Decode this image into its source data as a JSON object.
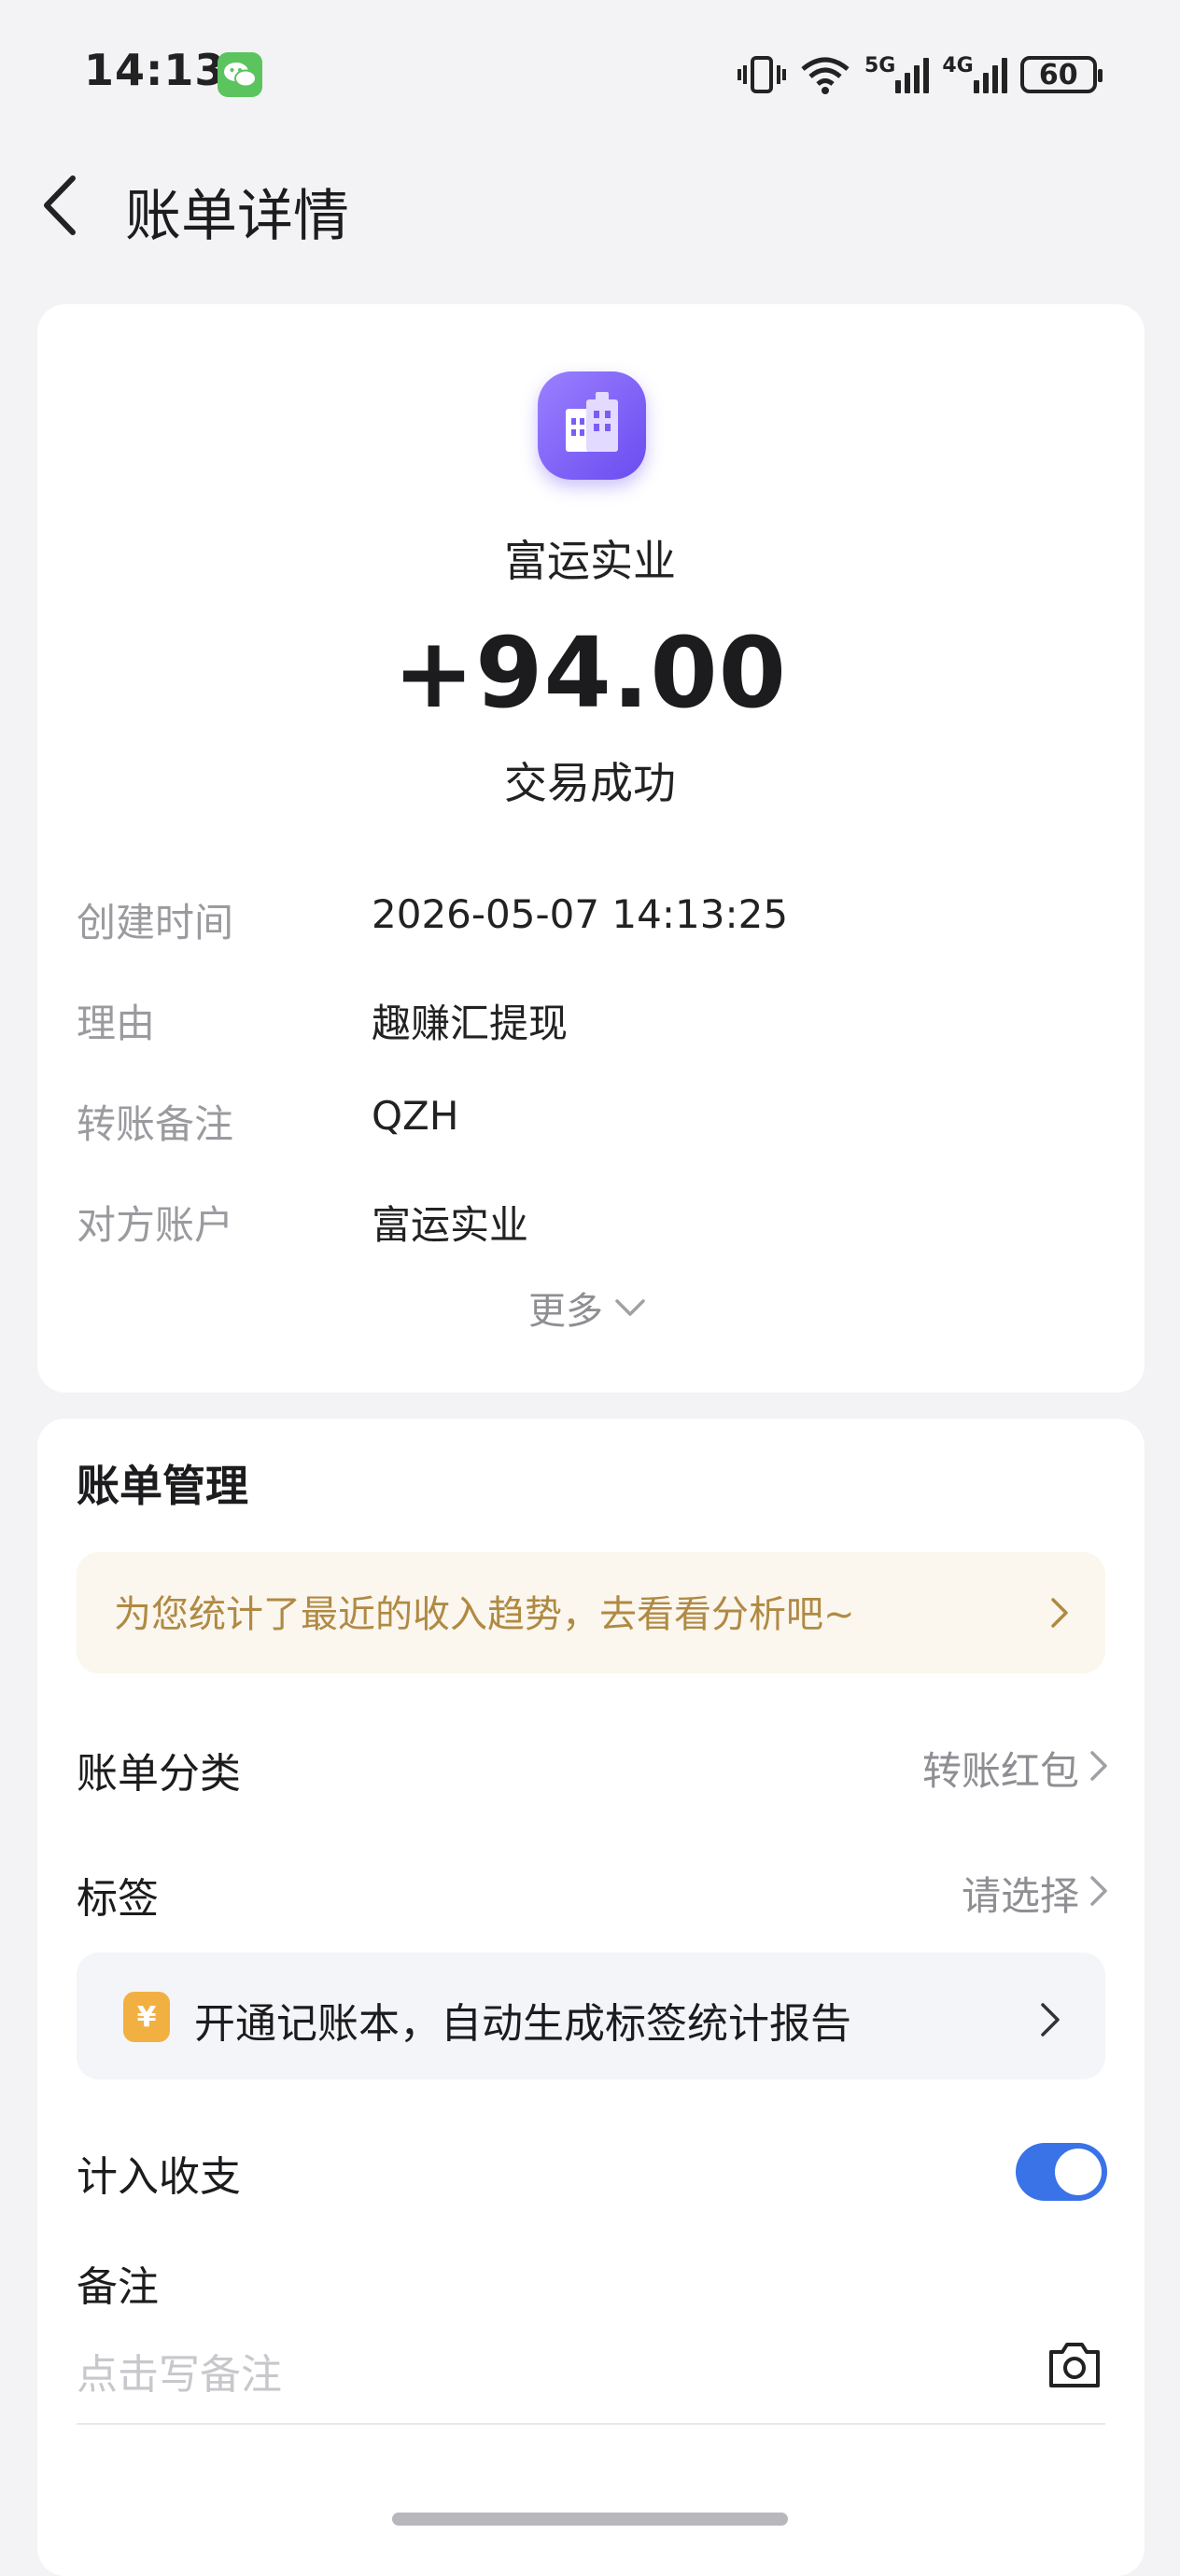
{
  "status_bar": {
    "time": "14:13",
    "network_5g": "5G",
    "network_4g": "4G",
    "battery": "60"
  },
  "header": {
    "title": "账单详情"
  },
  "transaction": {
    "merchant": "富运实业",
    "amount": "+94.00",
    "status": "交易成功",
    "details": [
      {
        "label": "创建时间",
        "value": "2026-05-07 14:13:25"
      },
      {
        "label": "理由",
        "value": "趣赚汇提现"
      },
      {
        "label": "转账备注",
        "value": "QZH"
      },
      {
        "label": "对方账户",
        "value": "富运实业"
      }
    ],
    "more_label": "更多"
  },
  "bill_management": {
    "title": "账单管理",
    "tip": "为您统计了最近的收入趋势，去看看分析吧~",
    "category_label": "账单分类",
    "category_value": "转账红包",
    "tag_label": "标签",
    "tag_value": "请选择",
    "promo_icon": "¥",
    "promo_text": "开通记账本，自动生成标签统计报告",
    "include_label": "计入收支",
    "include_on": true,
    "note_label": "备注",
    "note_placeholder": "点击写备注"
  },
  "colors": {
    "accent": "#3A72E8",
    "tip_text": "#B08A43",
    "merchant_icon": "#7B5CF5"
  }
}
